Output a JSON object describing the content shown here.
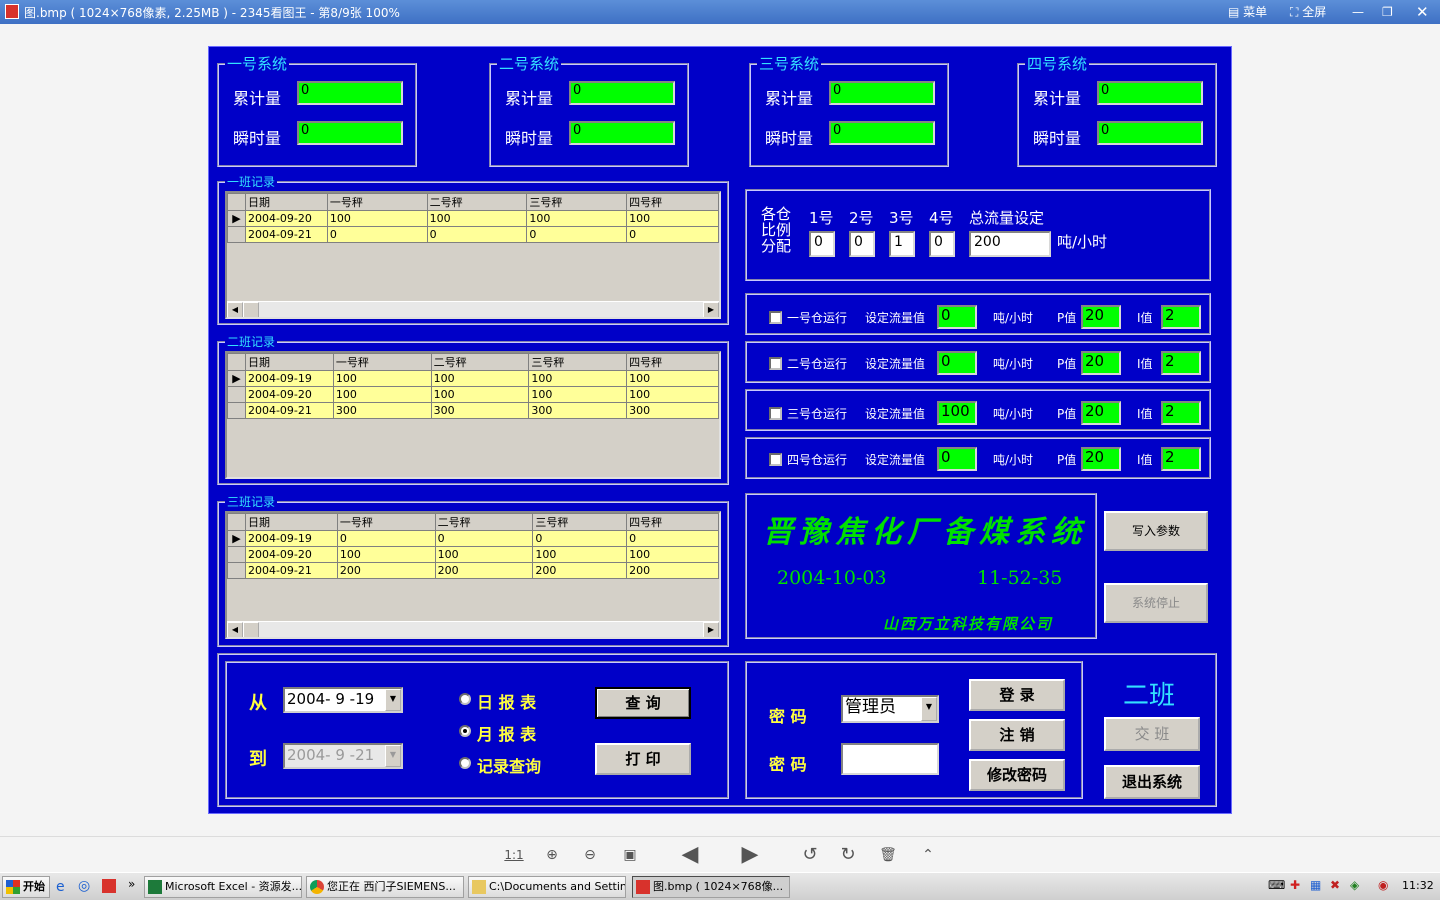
{
  "viewer": {
    "title": "图.bmp ( 1024×768像素, 2.25MB ) - 2345看图王 - 第8/9张 100%",
    "menu_label": "菜单",
    "fullscreen_label": "全屏"
  },
  "systems": [
    {
      "title": "一号系统",
      "cumulative_label": "累计量",
      "cumulative": "0",
      "instant_label": "瞬时量",
      "instant": "0"
    },
    {
      "title": "二号系统",
      "cumulative_label": "累计量",
      "cumulative": "0",
      "instant_label": "瞬时量",
      "instant": "0"
    },
    {
      "title": "三号系统",
      "cumulative_label": "累计量",
      "cumulative": "0",
      "instant_label": "瞬时量",
      "instant": "0"
    },
    {
      "title": "四号系统",
      "cumulative_label": "累计量",
      "cumulative": "0",
      "instant_label": "瞬时量",
      "instant": "0"
    }
  ],
  "shift_records": [
    {
      "title": "一班记录",
      "headers": [
        "日期",
        "一号秤",
        "二号秤",
        "三号秤",
        "四号秤"
      ],
      "rows": [
        [
          "2004-09-20",
          "100",
          "100",
          "100",
          "100"
        ],
        [
          "2004-09-21",
          "0",
          "0",
          "0",
          "0"
        ]
      ]
    },
    {
      "title": "二班记录",
      "headers": [
        "日期",
        "一号秤",
        "二号秤",
        "三号秤",
        "四号秤"
      ],
      "rows": [
        [
          "2004-09-19",
          "100",
          "100",
          "100",
          "100"
        ],
        [
          "2004-09-20",
          "100",
          "100",
          "100",
          "100"
        ],
        [
          "2004-09-21",
          "300",
          "300",
          "300",
          "300"
        ]
      ]
    },
    {
      "title": "三班记录",
      "headers": [
        "日期",
        "一号秤",
        "二号秤",
        "三号秤",
        "四号秤"
      ],
      "rows": [
        [
          "2004-09-19",
          "0",
          "0",
          "0",
          "0"
        ],
        [
          "2004-09-20",
          "100",
          "100",
          "100",
          "100"
        ],
        [
          "2004-09-21",
          "200",
          "200",
          "200",
          "200"
        ]
      ]
    }
  ],
  "ratio": {
    "label_line1": "各仓",
    "label_line2": "比例",
    "label_line3": "分配",
    "bins": [
      {
        "label": "1号",
        "value": "0"
      },
      {
        "label": "2号",
        "value": "0"
      },
      {
        "label": "3号",
        "value": "1"
      },
      {
        "label": "4号",
        "value": "0"
      }
    ],
    "total_label": "总流量设定",
    "total_value": "200",
    "unit": "吨/小时"
  },
  "bins": [
    {
      "run_label": "一号仓运行",
      "setpoint_label": "设定流量值",
      "setpoint": "0",
      "unit": "吨/小时",
      "p_label": "P值",
      "p": "20",
      "i_label": "I值",
      "i": "2"
    },
    {
      "run_label": "二号仓运行",
      "setpoint_label": "设定流量值",
      "setpoint": "0",
      "unit": "吨/小时",
      "p_label": "P值",
      "p": "20",
      "i_label": "I值",
      "i": "2"
    },
    {
      "run_label": "三号仓运行",
      "setpoint_label": "设定流量值",
      "setpoint": "100",
      "unit": "吨/小时",
      "p_label": "P值",
      "p": "20",
      "i_label": "I值",
      "i": "2"
    },
    {
      "run_label": "四号仓运行",
      "setpoint_label": "设定流量值",
      "setpoint": "0",
      "unit": "吨/小时",
      "p_label": "P值",
      "p": "20",
      "i_label": "I值",
      "i": "2"
    }
  ],
  "banner": {
    "title": "晋豫焦化厂备煤系统",
    "date": "2004-10-03",
    "time": "11-52-35",
    "company": "山西万立科技有限公司"
  },
  "actions": {
    "write_params": "写入参数",
    "stop_system": "系统停止"
  },
  "query": {
    "from_label": "从",
    "from_value": "2004- 9 -19",
    "to_label": "到",
    "to_value": "2004- 9 -21",
    "daily_report": "日 报 表",
    "monthly_report": "月 报 表",
    "record_query": "记录查询",
    "query_button": "查  询",
    "print_button": "打  印"
  },
  "login": {
    "user_label": "密  码",
    "user_value": "管理员",
    "password_label": "密  码",
    "login_button": "登  录",
    "logout_button": "注  销",
    "change_password_button": "修改密码"
  },
  "shift": {
    "current": "二班",
    "handover_button": "交  班",
    "exit_button": "退出系统"
  },
  "toolbar": {
    "actual_size": "1:1"
  },
  "taskbar": {
    "start": "开始",
    "tasks": [
      "Microsoft Excel - 资源发...",
      "您正在 西门子SIEMENS...",
      "C:\\Documents and Settin...",
      "图.bmp ( 1024×768像..."
    ],
    "clock": "11:32"
  }
}
